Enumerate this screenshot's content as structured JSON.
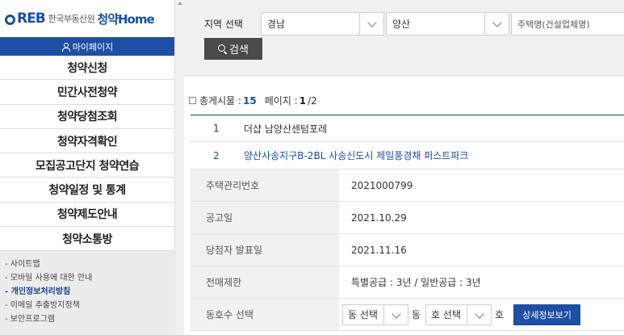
{
  "sidebar": {
    "logo": {
      "reb": "REB",
      "org": "한국부동산원",
      "brand": "청약Home"
    },
    "mypage_label": "마이페이지",
    "menu": [
      {
        "label": "청약신청"
      },
      {
        "label": "민간사전청약"
      },
      {
        "label": "청약당첨조회"
      },
      {
        "label": "청약자격확인"
      },
      {
        "label": "모집공고단지 청약연습"
      },
      {
        "label": "청약일정 및 통계"
      },
      {
        "label": "청약제도안내"
      },
      {
        "label": "청약소통방"
      }
    ],
    "links": [
      {
        "label": "- 사이트맵"
      },
      {
        "label": "- 모바일 사용에 대한 안내"
      },
      {
        "label": "- 개인정보처리방침"
      },
      {
        "label": "- 이메일 추출방지정책"
      },
      {
        "label": "- 보안프로그램"
      }
    ]
  },
  "filter": {
    "region_label": "지역 선택",
    "region_value": "경남",
    "district_value": "양산",
    "housing_placeholder": "주택명(건설업체명)",
    "search_label": "검색"
  },
  "summary": {
    "total_label": "총게시물 :",
    "total_count": "15",
    "page_label": "페이지 :",
    "current_page": "1",
    "total_pages": "/2"
  },
  "results": [
    {
      "no": "1",
      "name": "더샵 남양산센텀포레"
    },
    {
      "no": "2",
      "name": "양산사송지구B-2BL 사송신도시 제일풍경채 퍼스트파크"
    }
  ],
  "detail": {
    "rows": [
      {
        "key": "주택관리번호",
        "value": "2021000799"
      },
      {
        "key": "공고일",
        "value": "2021.10.29"
      },
      {
        "key": "당첨자 발표일",
        "value": "2021.11.16"
      },
      {
        "key": "전매제한",
        "value": "특별공급 : 3년 / 일반공급 : 3년"
      }
    ],
    "unit_row": {
      "key": "동호수 선택",
      "dong_select": "동 선택",
      "dong_unit": "동",
      "ho_select": "호 선택",
      "ho_unit": "호",
      "detail_button": "상세정보보기"
    }
  },
  "colors": {
    "primary": "#1f4ea3",
    "link": "#1a4ea8",
    "panel": "#f1f1f1"
  }
}
